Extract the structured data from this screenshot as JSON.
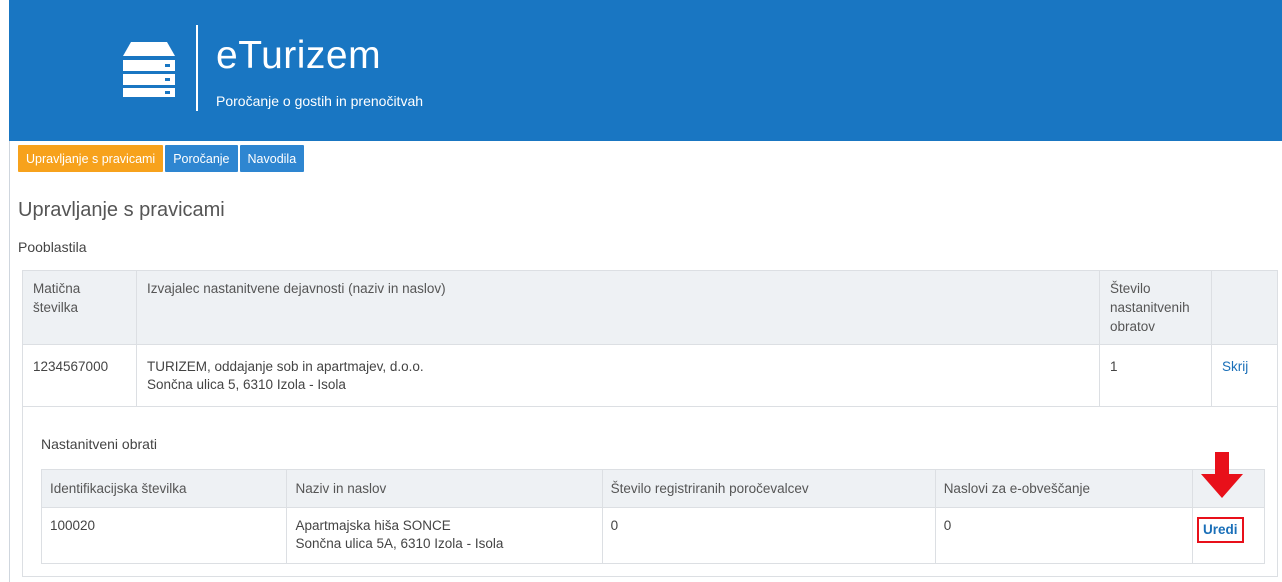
{
  "header": {
    "title": "eTurizem",
    "subtitle": "Poročanje o gostih in prenočitvah",
    "background_color": "#1976c2"
  },
  "nav": {
    "tabs": [
      {
        "label": "Upravljanje s pravicami",
        "active": true,
        "color": "#f7a21c"
      },
      {
        "label": "Poročanje",
        "active": false,
        "color": "#2e86d1"
      },
      {
        "label": "Navodila",
        "active": false,
        "color": "#2e86d1"
      }
    ]
  },
  "page": {
    "title": "Upravljanje s pravicami",
    "section_title": "Pooblastila"
  },
  "main_table": {
    "headers": [
      "Matična številka",
      "Izvajalec nastanitvene dejavnosti (naziv in naslov)",
      "Število nastanitvenih obratov",
      ""
    ],
    "row": {
      "maticna": "1234567000",
      "name": "TURIZEM, oddajanje sob in apartmajev, d.o.o.",
      "address": "Sončna ulica 5, 6310 Izola - Isola",
      "count": "1",
      "action": "Skrij"
    }
  },
  "sub_section": {
    "title": "Nastanitveni obrati",
    "headers": [
      "Identifikacijska številka",
      "Naziv in naslov",
      "Število registriranih poročevalcev",
      "Naslovi za e-obveščanje",
      ""
    ],
    "row": {
      "id": "100020",
      "name": "Apartmajska hiša SONCE",
      "address": "Sončna ulica 5A, 6310 Izola - Isola",
      "reporters": "0",
      "emails": "0",
      "action": "Uredi"
    }
  },
  "annotation": {
    "arrow_color": "#e8101a"
  }
}
